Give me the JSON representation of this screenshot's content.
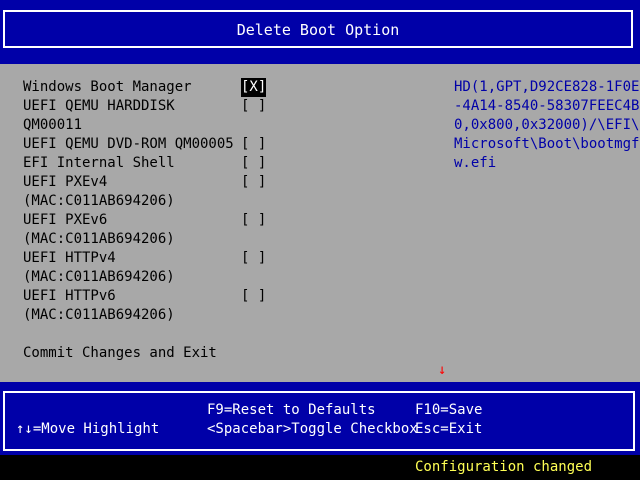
{
  "title": "Delete Boot Option",
  "boot_options": [
    {
      "label": "Windows Boot Manager",
      "label_line2": "",
      "checkbox": "[X]",
      "checked": true,
      "highlighted": true
    },
    {
      "label": "UEFI QEMU HARDDISK",
      "label_line2": "QM00011",
      "checkbox": "[ ]",
      "checked": false
    },
    {
      "label": "UEFI QEMU DVD-ROM QM00005",
      "label_line2": "",
      "checkbox": "[ ]",
      "checked": false
    },
    {
      "label": "EFI Internal Shell",
      "label_line2": "",
      "checkbox": "[ ]",
      "checked": false
    },
    {
      "label": "UEFI PXEv4",
      "label_line2": "(MAC:C011AB694206)",
      "checkbox": "[ ]",
      "checked": false
    },
    {
      "label": "UEFI PXEv6",
      "label_line2": "(MAC:C011AB694206)",
      "checkbox": "[ ]",
      "checked": false
    },
    {
      "label": "UEFI HTTPv4",
      "label_line2": "(MAC:C011AB694206)",
      "checkbox": "[ ]",
      "checked": false
    },
    {
      "label": "UEFI HTTPv6",
      "label_line2": "(MAC:C011AB694206)",
      "checkbox": "[ ]",
      "checked": false
    }
  ],
  "commit_label": "Commit Changes and Exit",
  "help_lines": [
    "HD(1,GPT,D92CE828-1F0E",
    "-4A14-8540-58307FEEC4B",
    "0,0x800,0x32000)/\\EFI\\",
    "Microsoft\\Boot\\bootmgf",
    "w.efi"
  ],
  "scroll_indicator": "↓",
  "footer": {
    "move_highlight": "↑↓=Move Highlight",
    "reset_defaults": "F9=Reset to Defaults",
    "toggle_checkbox": "<Spacebar>Toggle Checkbox",
    "save": "F10=Save",
    "exit": "Esc=Exit"
  },
  "status": "Configuration changed",
  "colors": {
    "background": "#0000a8",
    "panel": "#a8a8a8",
    "text": "#000000",
    "help_text": "#0000a8",
    "status_text": "#ffff54",
    "indicator": "#ff0000"
  }
}
